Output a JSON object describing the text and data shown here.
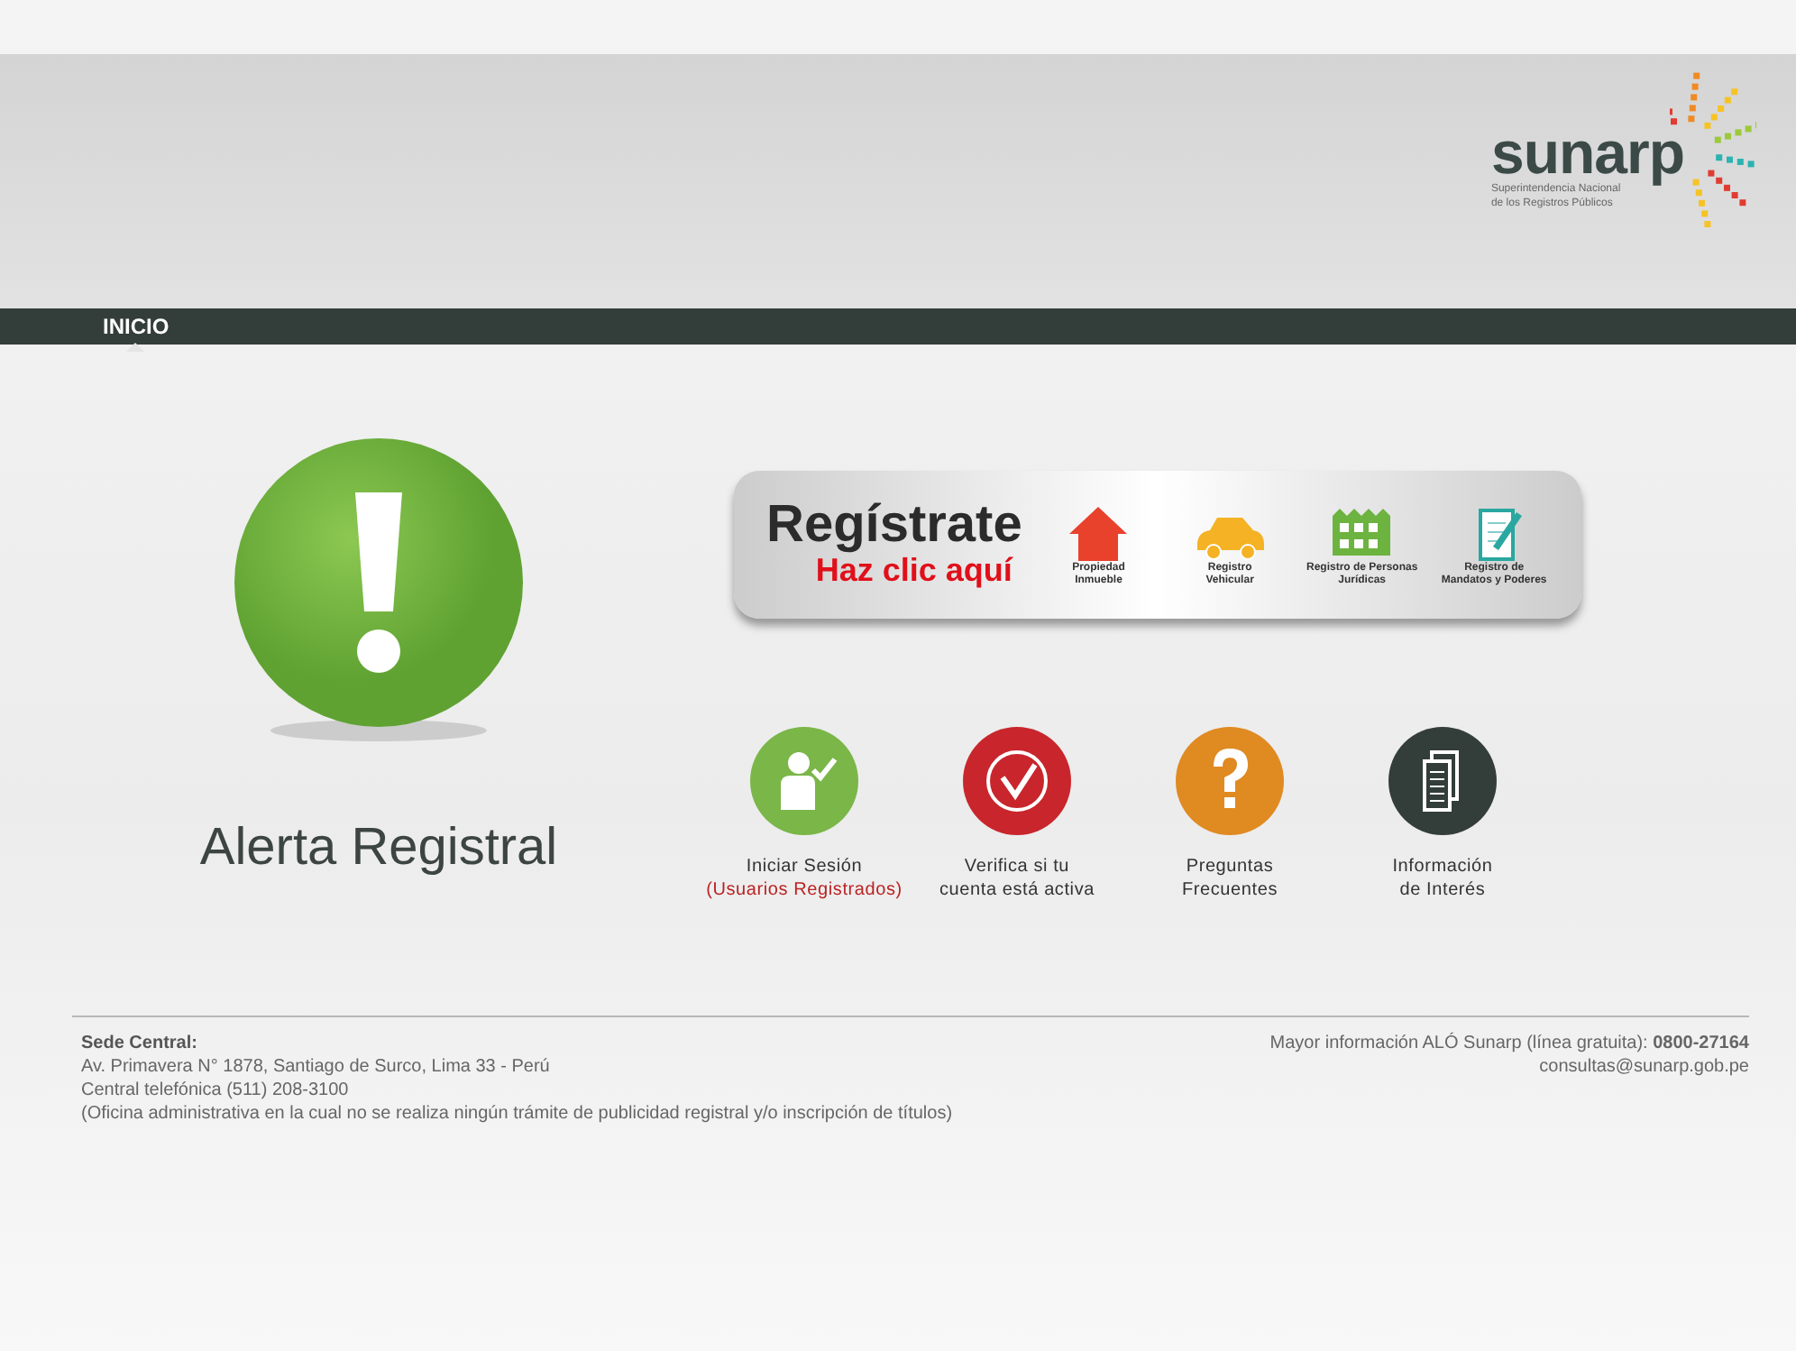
{
  "header": {
    "logo": {
      "name": "sunarp",
      "tagline": [
        "Superintendencia Nacional",
        "de los Registros Públicos"
      ]
    }
  },
  "nav": [
    {
      "label": "INICIO",
      "selected": true
    }
  ],
  "alert": {
    "title": "Alerta Registral"
  },
  "banner": {
    "title": "Regístrate",
    "subtitle": "Haz clic aquí",
    "items": [
      {
        "kind": "house",
        "lines": [
          "Propiedad",
          "Inmueble"
        ]
      },
      {
        "kind": "car",
        "lines": [
          "Registro",
          "Vehicular"
        ]
      },
      {
        "kind": "building",
        "lines": [
          "Registro de Personas",
          "Jurídicas"
        ]
      },
      {
        "kind": "document",
        "lines": [
          "Registro de",
          "Mandatos y Poderes"
        ]
      }
    ]
  },
  "actions": [
    {
      "kind": "user",
      "color": "#7ab648",
      "lines": [
        "Iniciar Sesión"
      ],
      "note": "(Usuarios Registrados)"
    },
    {
      "kind": "check",
      "color": "#c8262c",
      "lines": [
        "Verifica si tu",
        "cuenta está activa"
      ]
    },
    {
      "kind": "question",
      "color": "#e08a22",
      "lines": [
        "Preguntas",
        "Frecuentes"
      ]
    },
    {
      "kind": "pages",
      "color": "#333d3a",
      "lines": [
        "Información",
        "de Interés"
      ]
    }
  ],
  "footer": {
    "heading": "Sede Central:",
    "lines": [
      "Av. Primavera N° 1878, Santiago de Surco, Lima 33 - Perú",
      "Central telefónica (511) 208-3100",
      "(Oficina administrativa en la cual no se realiza ningún trámite de publicidad registral y/o inscripción de títulos)"
    ],
    "info": "Mayor información ALÓ Sunarp (línea gratuita): **0800-27164**",
    "email": "consultas@sunarp.gob.pe"
  }
}
